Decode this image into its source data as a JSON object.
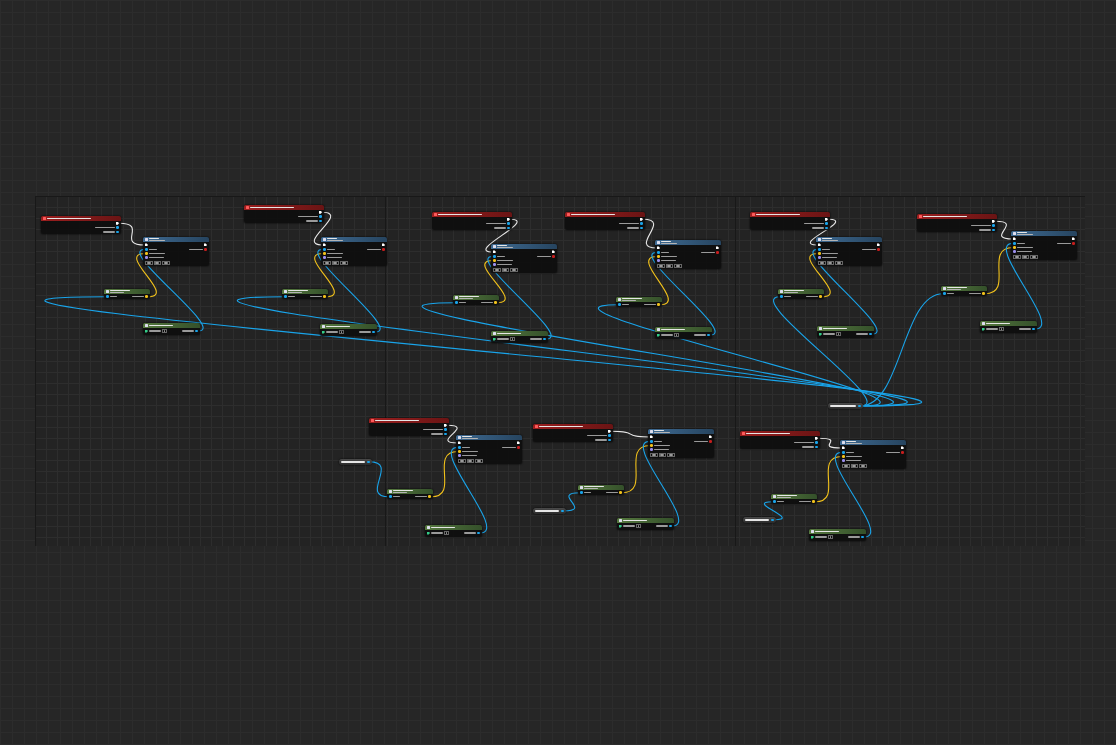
{
  "shared_reference": true,
  "groups": [
    {
      "reference": false
    },
    {
      "reference": false
    },
    {
      "reference": false
    },
    {
      "reference": false
    },
    {
      "reference": false
    },
    {
      "reference": false
    },
    {
      "reference": true
    },
    {
      "reference": true
    },
    {
      "reference": true
    }
  ]
}
